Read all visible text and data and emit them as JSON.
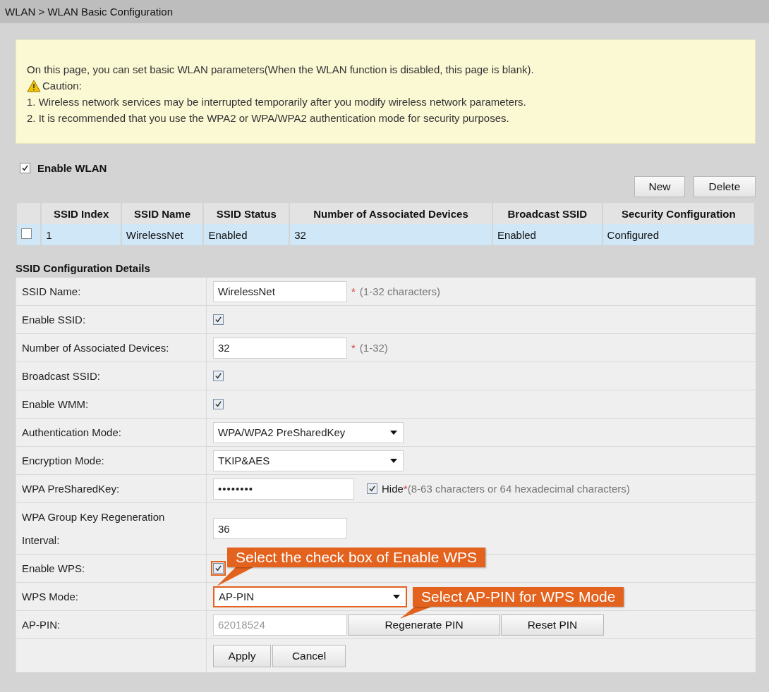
{
  "breadcrumb": "WLAN > WLAN Basic Configuration",
  "notice": {
    "intro": "On this page, you can set basic WLAN parameters(When the WLAN function is disabled, this page is blank).",
    "caution": "Caution:",
    "items": [
      "1. Wireless network services may be interrupted temporarily after you modify wireless network parameters.",
      "2. It is recommended that you use the WPA2 or WPA/WPA2 authentication mode for security purposes."
    ]
  },
  "enable_wlan": {
    "label": "Enable WLAN",
    "checked": true
  },
  "table_buttons": [
    "New",
    "Delete"
  ],
  "table": {
    "columns": [
      "SSID Index",
      "SSID Name",
      "SSID Status",
      "Number of Associated Devices",
      "Broadcast SSID",
      "Security Configuration"
    ],
    "rows": [
      {
        "selected": false,
        "cells": [
          "1",
          "WirelessNet",
          "Enabled",
          "32",
          "Enabled",
          "Configured"
        ]
      }
    ]
  },
  "section_title": "SSID Configuration Details",
  "fields": [
    {
      "kind": "text",
      "label": "SSID Name:",
      "value": "WirelessNet",
      "required": "*",
      "hint": "(1-32 characters)"
    },
    {
      "kind": "checkbox",
      "label": "Enable SSID:",
      "checked": true
    },
    {
      "kind": "text",
      "label": "Number of Associated Devices:",
      "value": "32",
      "required": "*",
      "hint": "(1-32)"
    },
    {
      "kind": "checkbox",
      "label": "Broadcast SSID:",
      "checked": true
    },
    {
      "kind": "checkbox",
      "label": "Enable WMM:",
      "checked": true
    },
    {
      "kind": "select",
      "label": "Authentication Mode:",
      "value": "WPA/WPA2 PreSharedKey",
      "highlighted": false
    },
    {
      "kind": "select",
      "label": "Encryption Mode:",
      "value": "TKIP&AES",
      "highlighted": false
    },
    {
      "kind": "password",
      "label": "WPA PreSharedKey:",
      "value": "••••••••",
      "hide_label": "Hide",
      "hide_checked": true,
      "required": "*",
      "hint": "(8-63 characters or 64 hexadecimal characters)"
    },
    {
      "kind": "text",
      "label": "WPA Group Key Regeneration Interval:",
      "value": "36"
    },
    {
      "kind": "checkbox",
      "label": "Enable WPS:",
      "checked": true,
      "highlighted": true
    },
    {
      "kind": "select",
      "label": "WPS Mode:",
      "value": "AP-PIN",
      "highlighted": true
    },
    {
      "kind": "pin",
      "label": "AP-PIN:",
      "value": "62018524",
      "disabled": true,
      "buttons": [
        "Regenerate PIN",
        "Reset PIN"
      ]
    }
  ],
  "actions": [
    "Apply",
    "Cancel"
  ],
  "callouts": [
    {
      "text": "Select the check box of Enable WPS"
    },
    {
      "text": "Select AP-PIN for WPS Mode"
    }
  ]
}
